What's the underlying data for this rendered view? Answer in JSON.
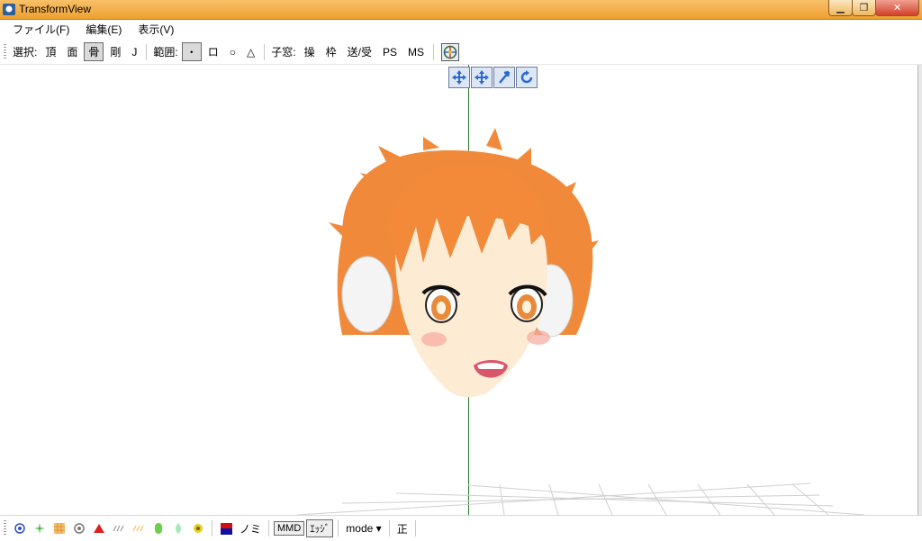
{
  "window": {
    "title": "TransformView",
    "controls": {
      "minimize": "▁",
      "maximize": "❐",
      "close": "✕"
    }
  },
  "menu": [
    "ファイル(F)",
    "編集(E)",
    "表示(V)"
  ],
  "toolbar": {
    "select_label": "選択:",
    "select_items": [
      "頂",
      "面",
      "骨",
      "剛",
      "J"
    ],
    "active_select": "骨",
    "range_label": "範囲:",
    "range_items": [
      "・",
      "ロ",
      "○",
      "△"
    ],
    "child_label": "子窓:",
    "child_items": [
      "操",
      "枠",
      "送/受",
      "PS",
      "MS"
    ]
  },
  "bottombar": {
    "no_label": "ノミ",
    "mmd_label": "MMD",
    "edge_label": "ｴｯｼﾞ",
    "mode_label": "mode",
    "mode_arrow": "▾",
    "correct_label": "正"
  },
  "colors": {
    "titlebar": "#f0a93a",
    "axis": "#2a7a2a",
    "hair": "#f28a3a"
  }
}
